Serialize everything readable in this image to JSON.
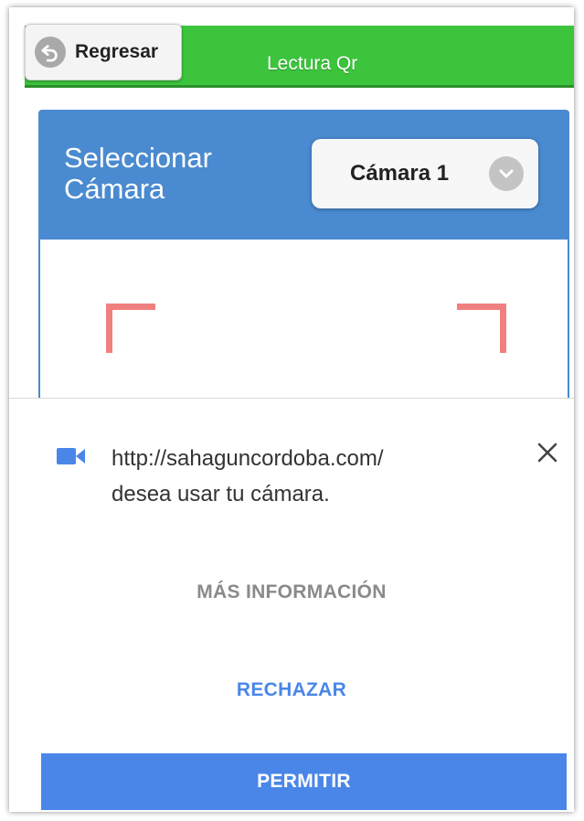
{
  "header": {
    "back_label": "Regresar",
    "back_icon": "undo-arrow-icon",
    "title": "Lectura Qr"
  },
  "camera_panel": {
    "title_line1": "Seleccionar",
    "title_line2": "Cámara",
    "selected_camera": "Cámara 1",
    "chevron_icon": "chevron-down-icon"
  },
  "permission_prompt": {
    "icon": "videocam-icon",
    "url": "http://sahaguncordoba.com/",
    "message": "desea usar tu cámara.",
    "close_icon": "close-icon",
    "more_info_label": "MÁS INFORMACIÓN",
    "reject_label": "RECHAZAR",
    "allow_label": "PERMITIR"
  },
  "colors": {
    "header_green": "#3cc43c",
    "panel_blue": "#4a8ad0",
    "accent_blue": "#4a86e8",
    "scanner_corner": "#f08080"
  }
}
